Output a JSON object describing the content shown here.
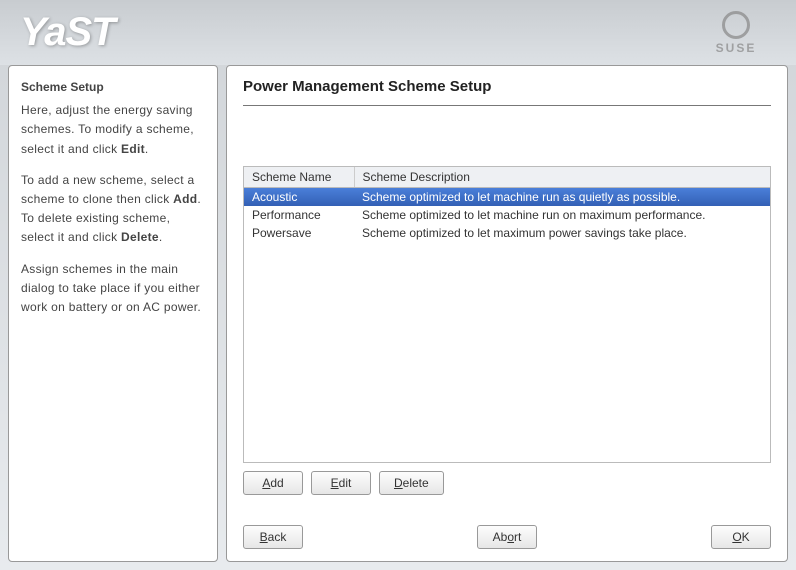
{
  "header": {
    "logo_text": "YaST",
    "brand_text": "SUSE"
  },
  "help": {
    "title": "Scheme Setup",
    "p1_pre": "Here, adjust the energy saving schemes. To modify a scheme, select it and click ",
    "p1_bold": "Edit",
    "p1_post": ".",
    "p2_pre": "To add a new scheme, select a scheme to clone then click ",
    "p2_bold1": "Add",
    "p2_mid": ". To delete existing scheme, select it and click ",
    "p2_bold2": "Delete",
    "p2_post": ".",
    "p3": "Assign schemes in the main dialog to take place if you either work on battery or on AC power."
  },
  "main": {
    "title": "Power Management Scheme Setup",
    "columns": {
      "name": "Scheme Name",
      "desc": "Scheme Description"
    },
    "rows": [
      {
        "name": "Acoustic",
        "desc": "Scheme optimized to let machine run as quietly as possible.",
        "selected": true
      },
      {
        "name": "Performance",
        "desc": "Scheme optimized to let machine run on maximum performance.",
        "selected": false
      },
      {
        "name": "Powersave",
        "desc": "Scheme optimized to let maximum power savings take place.",
        "selected": false
      }
    ],
    "scheme_buttons": {
      "add": {
        "pre": "",
        "accel": "A",
        "post": "dd"
      },
      "edit": {
        "pre": "",
        "accel": "E",
        "post": "dit"
      },
      "delete": {
        "pre": "",
        "accel": "D",
        "post": "elete"
      }
    },
    "nav": {
      "back": {
        "pre": "",
        "accel": "B",
        "post": "ack"
      },
      "abort": {
        "pre": "Ab",
        "accel": "o",
        "post": "rt"
      },
      "ok": {
        "pre": "",
        "accel": "O",
        "post": "K"
      }
    }
  }
}
